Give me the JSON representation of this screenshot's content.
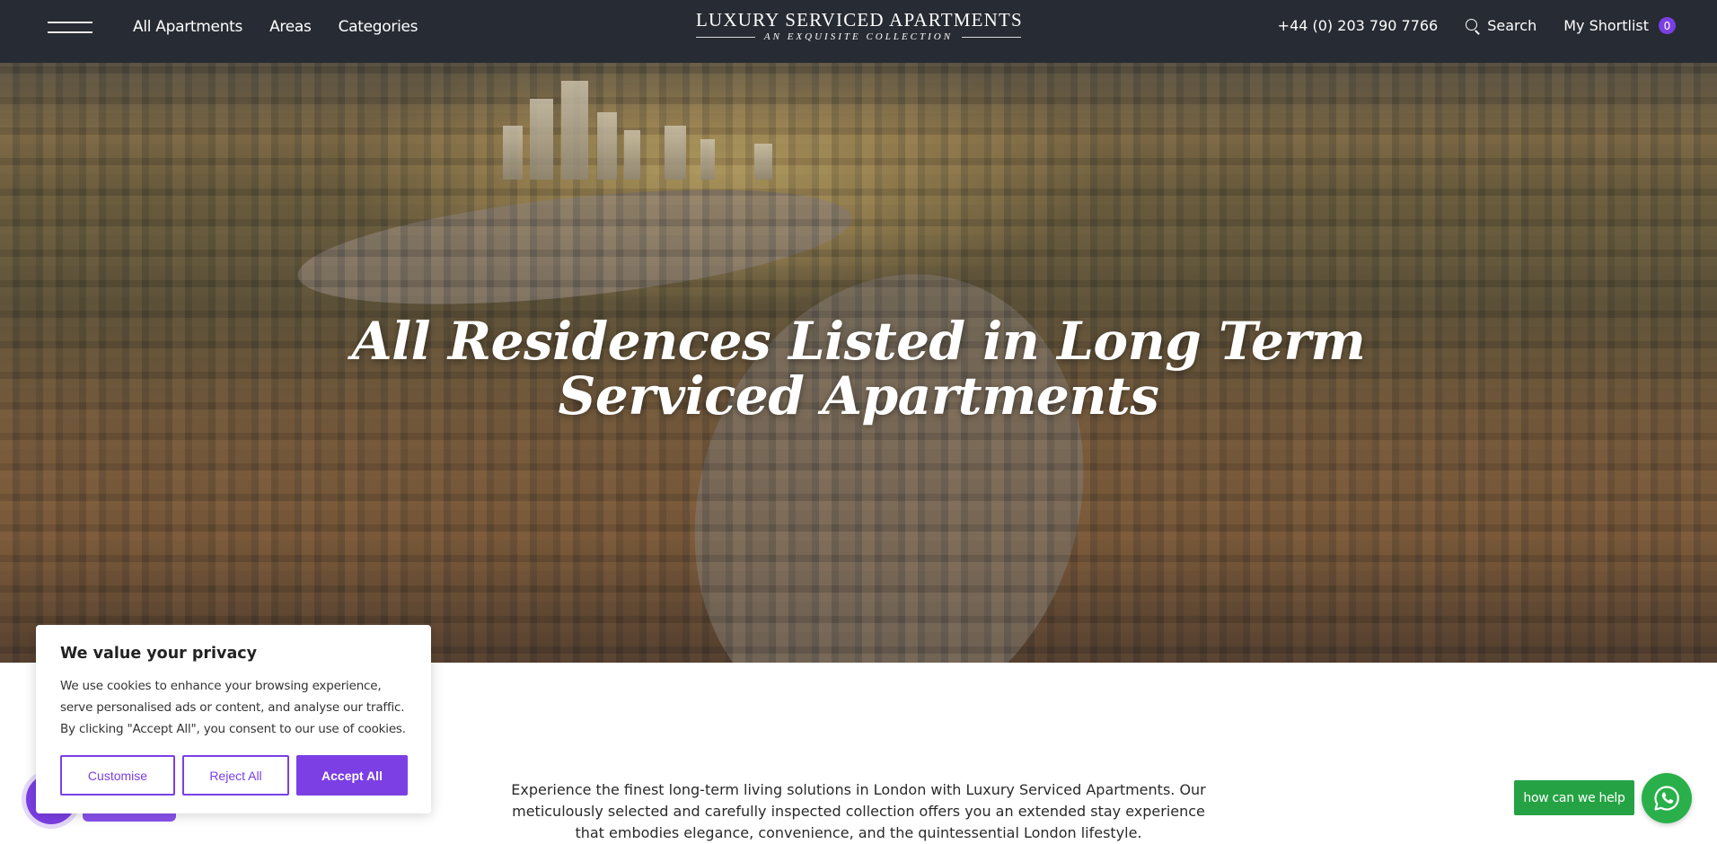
{
  "header": {
    "menu_label": "Menu",
    "nav": [
      "All Apartments",
      "Areas",
      "Categories"
    ],
    "logo_title": "LUXURY SERVICED APARTMENTS",
    "logo_tagline": "AN EXQUISITE COLLECTION",
    "phone": "+44 (0) 203 790 7766",
    "search_label": "Search",
    "shortlist_label": "My Shortlist",
    "shortlist_count": "0"
  },
  "hero": {
    "title_line1": "All Residences Listed in Long Term",
    "title_line2": "Serviced Apartments"
  },
  "intro": {
    "text": "Experience the finest long-term living solutions in London with Luxury Serviced Apartments. Our meticulously selected and carefully inspected collection offers you an extended stay experience that embodies elegance, convenience, and the quintessential London lifestyle."
  },
  "cookie": {
    "title": "We value your privacy",
    "body": "We use cookies to enhance your browsing experience, serve personalised ads or content, and analyse our traffic. By clicking \"Accept All\", you consent to our use of cookies.",
    "customise": "Customise",
    "reject": "Reject All",
    "accept": "Accept All"
  },
  "whatsapp": {
    "label": "how can we help"
  },
  "colors": {
    "header_bg": "#272b33",
    "accent_purple": "#7b3fe4",
    "whatsapp_green": "#29b04a"
  },
  "icons": [
    "hamburger-icon",
    "search-icon",
    "whatsapp-icon"
  ]
}
